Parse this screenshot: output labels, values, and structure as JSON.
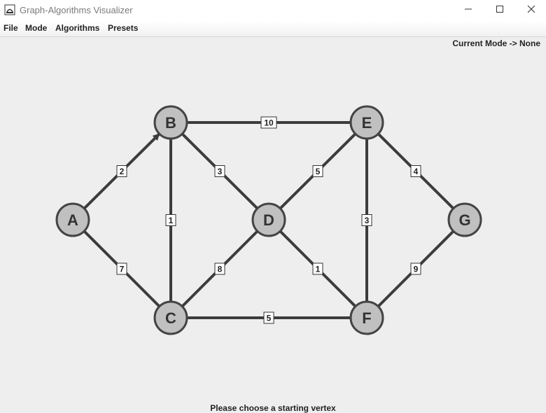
{
  "window": {
    "title": "Graph-Algorithms Visualizer"
  },
  "menu": {
    "items": [
      "File",
      "Mode",
      "Algorithms",
      "Presets"
    ]
  },
  "mode_label": "Current Mode -> None",
  "status": "Please choose a starting vertex",
  "graph": {
    "nodes": [
      {
        "id": "A",
        "label": "A"
      },
      {
        "id": "B",
        "label": "B"
      },
      {
        "id": "C",
        "label": "C"
      },
      {
        "id": "D",
        "label": "D"
      },
      {
        "id": "E",
        "label": "E"
      },
      {
        "id": "F",
        "label": "F"
      },
      {
        "id": "G",
        "label": "G"
      }
    ],
    "edges": [
      {
        "from": "A",
        "to": "B",
        "weight": "2",
        "directed": true
      },
      {
        "from": "A",
        "to": "C",
        "weight": "7",
        "directed": false
      },
      {
        "from": "B",
        "to": "C",
        "weight": "1",
        "directed": false
      },
      {
        "from": "B",
        "to": "D",
        "weight": "3",
        "directed": false
      },
      {
        "from": "B",
        "to": "E",
        "weight": "10",
        "directed": false
      },
      {
        "from": "C",
        "to": "D",
        "weight": "8",
        "directed": false
      },
      {
        "from": "C",
        "to": "F",
        "weight": "5",
        "directed": false
      },
      {
        "from": "D",
        "to": "E",
        "weight": "5",
        "directed": false
      },
      {
        "from": "D",
        "to": "F",
        "weight": "1",
        "directed": false
      },
      {
        "from": "E",
        "to": "F",
        "weight": "3",
        "directed": false
      },
      {
        "from": "E",
        "to": "G",
        "weight": "4",
        "directed": false
      },
      {
        "from": "F",
        "to": "G",
        "weight": "9",
        "directed": false
      }
    ],
    "colors": {
      "node_fill": "#c0c0c0",
      "node_stroke": "#444444",
      "edge": "#3c3c3c",
      "weight_box": "#ffffff"
    }
  }
}
